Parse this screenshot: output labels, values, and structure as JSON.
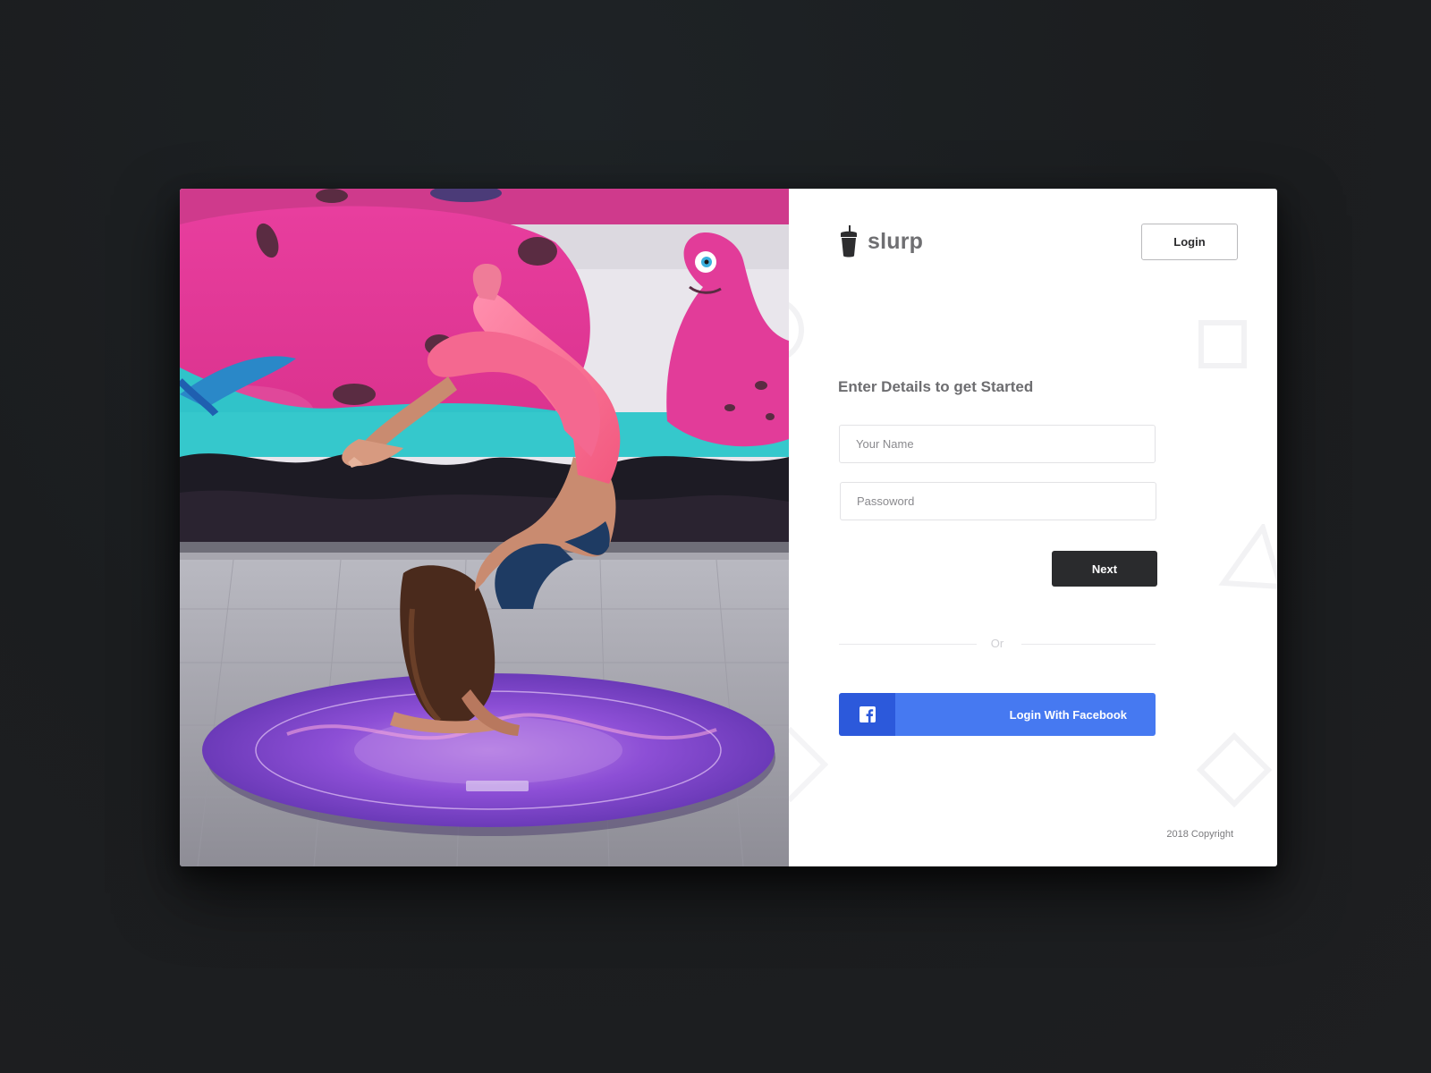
{
  "brand": {
    "name": "slurp",
    "logo_icon": "cup-with-straw-icon"
  },
  "header": {
    "login_label": "Login"
  },
  "form": {
    "heading": "Enter Details to get Started",
    "name_placeholder": "Your Name",
    "name_value": "",
    "password_placeholder": "Passoword",
    "password_value": "",
    "next_label": "Next"
  },
  "divider": {
    "label": "Or"
  },
  "social": {
    "facebook_label": "Login With Facebook",
    "facebook_icon": "facebook-icon"
  },
  "footer": {
    "copyright": "2018 Copyright"
  },
  "colors": {
    "page_background": "#1c1e20",
    "primary_button": "#2a2b2d",
    "facebook_icon_bg": "#2c59db",
    "facebook_bg": "#4679f1",
    "brand_text": "#6f6f72"
  }
}
